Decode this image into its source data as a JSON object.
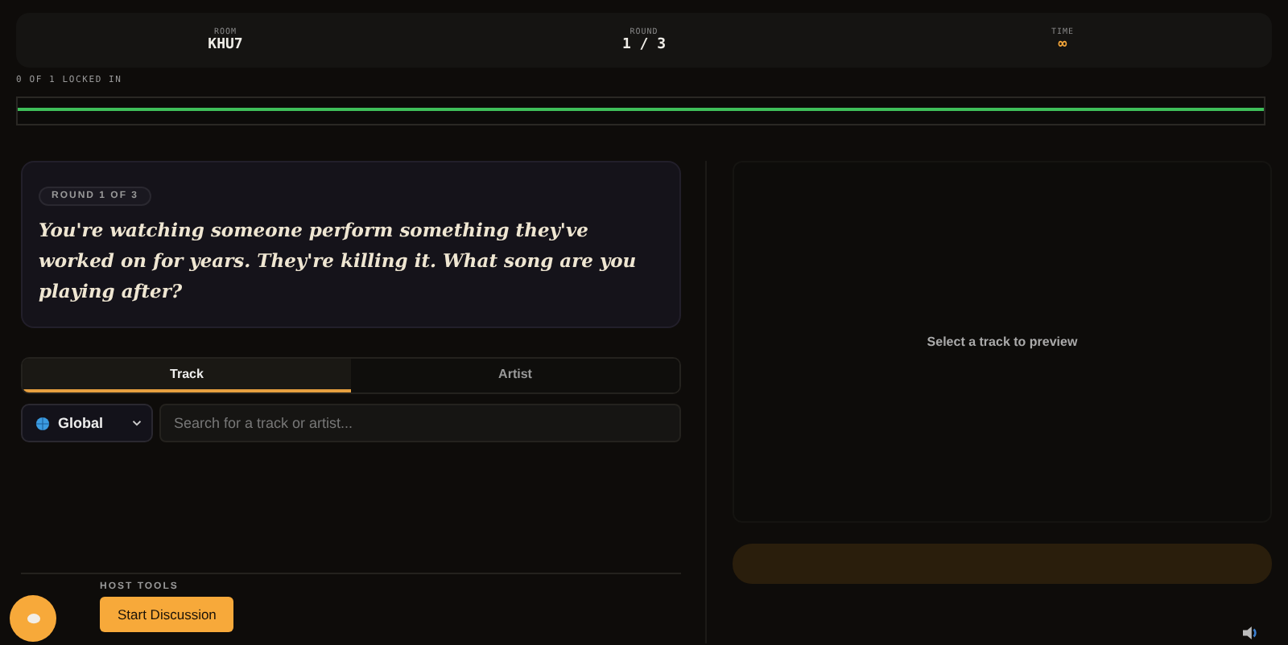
{
  "header": {
    "stats": [
      {
        "label": "ROOM",
        "value": "KHU7",
        "kind": "plain"
      },
      {
        "label": "ROUND",
        "value": "1 / 3",
        "kind": "plain"
      },
      {
        "label": "TIME",
        "value": "∞",
        "kind": "accent"
      }
    ]
  },
  "lock_status": "0 OF 1 LOCKED IN",
  "prompt": {
    "badge": "ROUND 1 OF 3",
    "question": "You're watching someone perform something they've worked on for years. They're killing it. What song are you playing after?"
  },
  "tabs": [
    {
      "label": "Track",
      "selected": true
    },
    {
      "label": "Artist",
      "selected": false
    }
  ],
  "region_select": {
    "value": "Global"
  },
  "search": {
    "placeholder": "Search for a track or artist..."
  },
  "host_tools": {
    "title": "HOST TOOLS",
    "button": "Start Discussion"
  },
  "preview": {
    "empty_text": "Select a track to preview",
    "submit_disabled": true
  }
}
